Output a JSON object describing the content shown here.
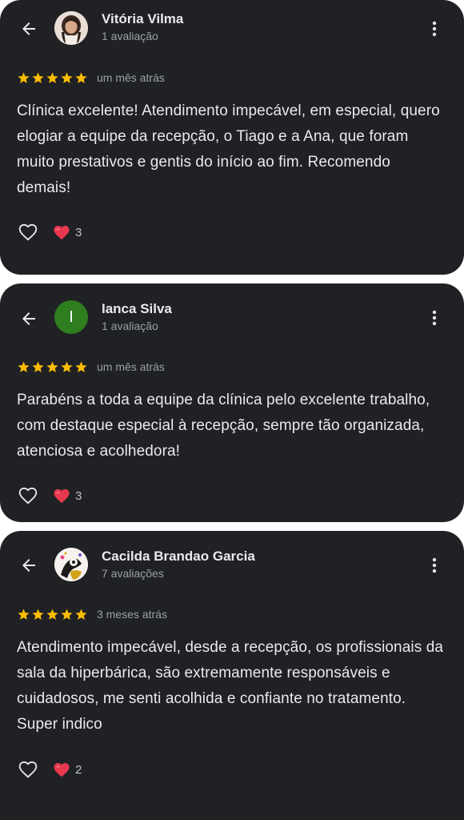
{
  "colors": {
    "card_bg": "#202124",
    "text_primary": "#e8eaed",
    "text_secondary": "#9aa0a6",
    "star": "#fbbc04",
    "heart": "#e8384f",
    "avatar_letter_bg": "#2e7d1e"
  },
  "reviews": [
    {
      "author": "Vitória Vilma",
      "meta": "1 avaliação",
      "avatar": "photo-woman",
      "rating": 5,
      "date": "um mês atrás",
      "text": "Clínica excelente! Atendimento impecável, em especial, quero elogiar a equipe da recepção, o Tiago e a Ana, que foram muito prestativos e gentis do início ao fim. Recomendo demais!",
      "reactions": "3"
    },
    {
      "author": "Ianca Silva",
      "meta": "1 avaliação",
      "avatar": "letter",
      "avatar_letter": "I",
      "rating": 5,
      "date": "um mês atrás",
      "text": "Parabéns a toda a equipe da clínica pelo excelente trabalho, com destaque especial à recepção, sempre tão organizada, atenciosa e acolhedora!",
      "reactions": "3"
    },
    {
      "author": "Cacilda Brandao Garcia",
      "meta": "7 avaliações",
      "avatar": "photo-illustration",
      "rating": 5,
      "date": "3 meses atrás",
      "text": "Atendimento impecável, desde a recepção, os profissionais da sala da hiperbárica, são extremamente responsáveis e cuidadosos, me senti acolhida e confiante no tratamento. Super indico",
      "reactions": "2"
    }
  ],
  "icons": {
    "back": "arrow-left-icon",
    "more": "more-vert-icon",
    "like": "heart-outline-icon",
    "reaction": "red-heart-emoji-icon",
    "star": "star-icon"
  }
}
